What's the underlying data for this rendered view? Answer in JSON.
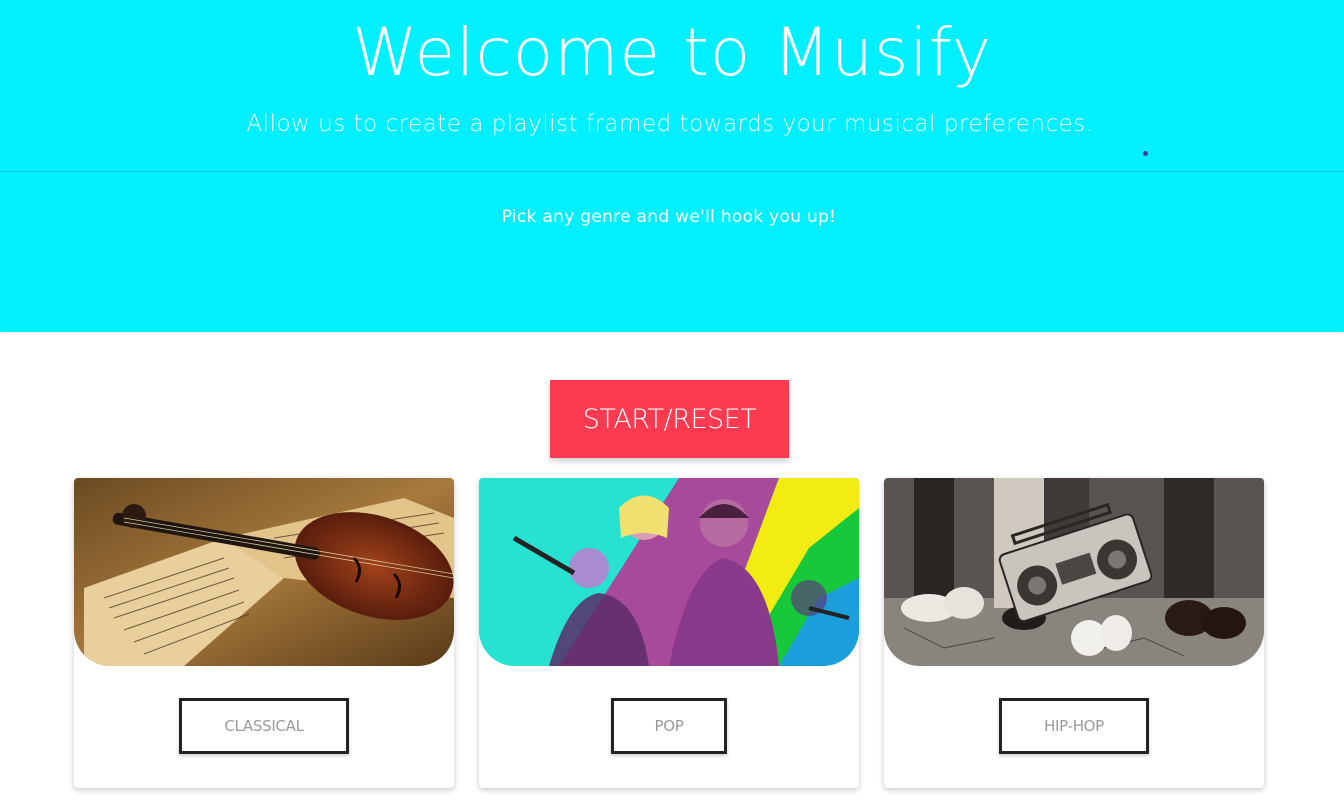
{
  "hero": {
    "title": "Welcome to Musify",
    "subtitle": "Allow us to create a playlist framed towards your musical preferences.",
    "tagline": "Pick any genre and we'll hook you up!"
  },
  "controls": {
    "start_label": "START/RESET"
  },
  "genres": [
    {
      "label": "CLASSICAL",
      "image": "violin-sheet-music-image"
    },
    {
      "label": "POP",
      "image": "pop-artists-collage-image"
    },
    {
      "label": "HIP-HOP",
      "image": "boombox-sneakers-image"
    }
  ],
  "colors": {
    "hero_bg": "#00f0ff",
    "start_button_bg": "#fd3a4f",
    "text_on_hero": "#ffffff"
  }
}
